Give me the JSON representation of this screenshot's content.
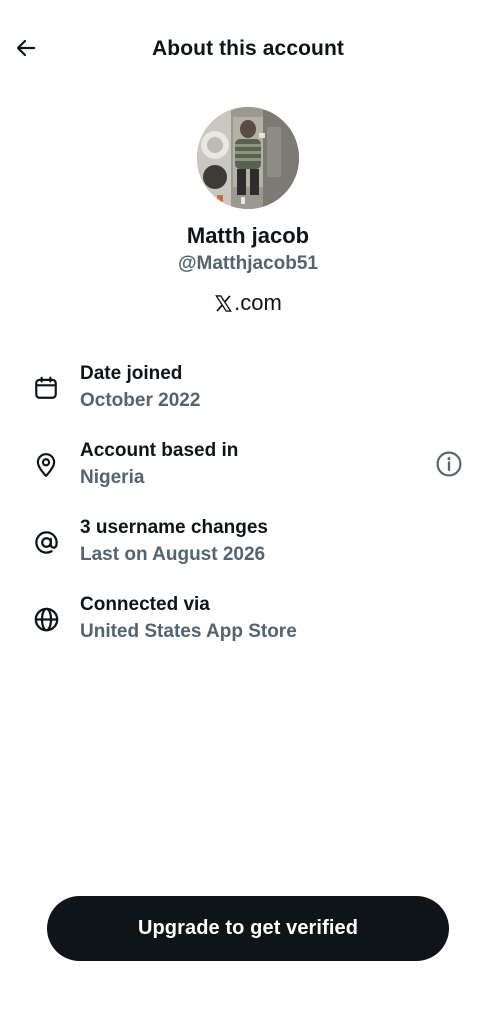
{
  "header": {
    "title": "About this account",
    "back_icon": "arrow-left-icon"
  },
  "profile": {
    "display_name": "Matth jacob",
    "handle": "@Matthjacob51",
    "site_suffix": ".com",
    "site_logo_icon": "x-logo-icon"
  },
  "details": [
    {
      "icon": "calendar-icon",
      "title": "Date joined",
      "value": "October 2022"
    },
    {
      "icon": "location-pin-icon",
      "title": "Account based in",
      "value": "Nigeria",
      "trailing_icon": "info-icon"
    },
    {
      "icon": "at-sign-icon",
      "title": "3 username changes",
      "value": "Last on August 2026"
    },
    {
      "icon": "globe-icon",
      "title": "Connected via",
      "value": "United States App Store"
    }
  ],
  "cta": {
    "label": "Upgrade to get verified"
  },
  "colors": {
    "text_primary": "#0f1419",
    "text_secondary": "#536471",
    "button_bg": "#0f1419",
    "button_text": "#ffffff",
    "background": "#ffffff"
  }
}
